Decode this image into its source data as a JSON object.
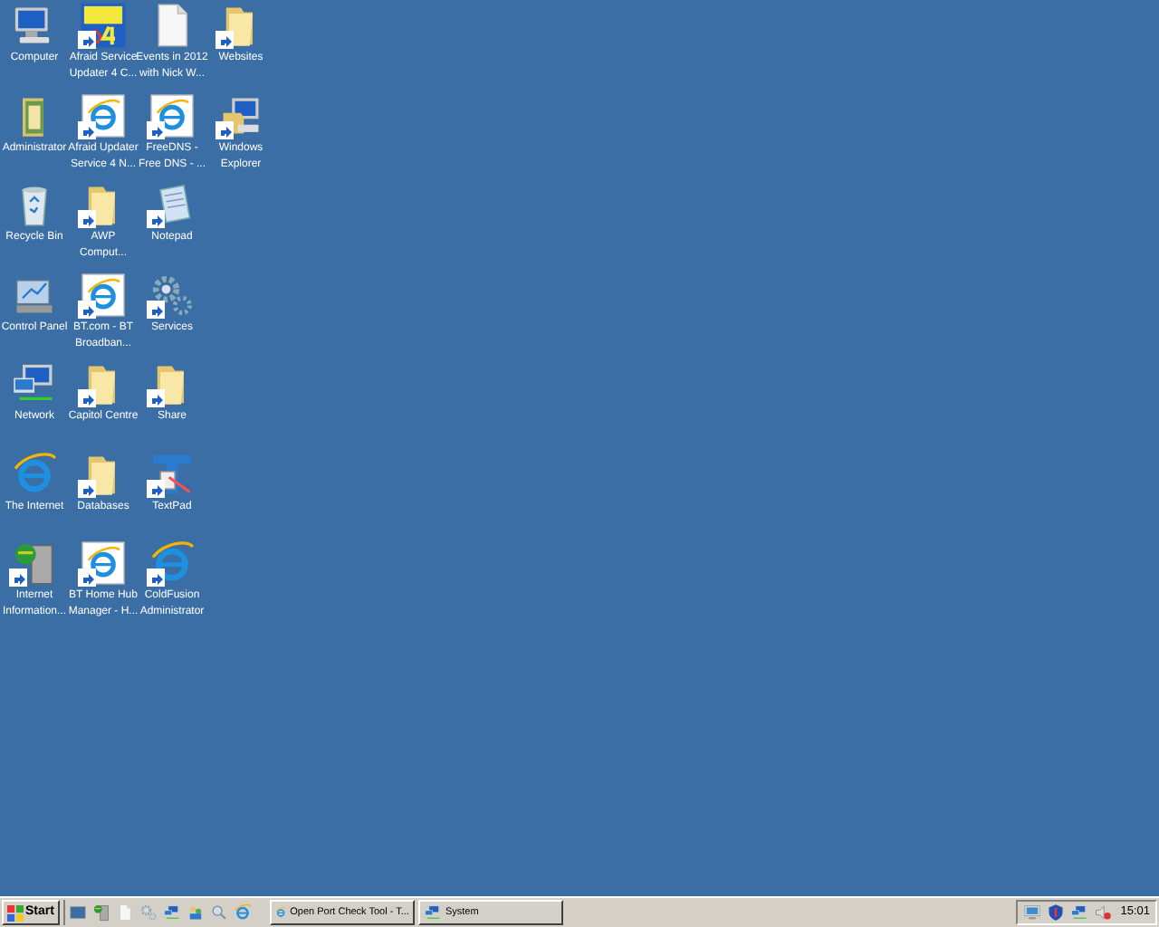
{
  "desktop": {
    "rows": [
      [
        {
          "kind": "computer",
          "lines": [
            "Computer"
          ],
          "shortcut": false
        },
        {
          "kind": "asu",
          "lines": [
            "Afraid Service",
            "Updater 4 C..."
          ],
          "shortcut": true
        },
        {
          "kind": "document",
          "lines": [
            "Events in 2012",
            "with Nick W..."
          ],
          "shortcut": false
        },
        {
          "kind": "folder",
          "lines": [
            "Websites"
          ],
          "shortcut": true
        }
      ],
      [
        {
          "kind": "user-folder",
          "lines": [
            "Administrator"
          ],
          "shortcut": false
        },
        {
          "kind": "ie-page",
          "lines": [
            "Afraid Updater",
            "Service 4  N..."
          ],
          "shortcut": true
        },
        {
          "kind": "ie-page",
          "lines": [
            "FreeDNS -",
            "Free DNS - ..."
          ],
          "shortcut": true
        },
        {
          "kind": "explorer",
          "lines": [
            "Windows",
            "Explorer"
          ],
          "shortcut": true
        }
      ],
      [
        {
          "kind": "recycle",
          "lines": [
            "Recycle Bin"
          ],
          "shortcut": false
        },
        {
          "kind": "folder",
          "lines": [
            "AWP",
            "Comput..."
          ],
          "shortcut": true
        },
        {
          "kind": "notepad",
          "lines": [
            "Notepad"
          ],
          "shortcut": true
        }
      ],
      [
        {
          "kind": "control-panel",
          "lines": [
            "Control Panel"
          ],
          "shortcut": false
        },
        {
          "kind": "ie-page",
          "lines": [
            "BT.com - BT",
            "Broadban..."
          ],
          "shortcut": true
        },
        {
          "kind": "gears",
          "lines": [
            "Services"
          ],
          "shortcut": true
        }
      ],
      [
        {
          "kind": "network",
          "lines": [
            "Network"
          ],
          "shortcut": false
        },
        {
          "kind": "folder",
          "lines": [
            "Capitol Centre"
          ],
          "shortcut": true
        },
        {
          "kind": "folder",
          "lines": [
            "Share"
          ],
          "shortcut": true
        }
      ],
      [
        {
          "kind": "ie",
          "lines": [
            "The Internet"
          ],
          "shortcut": false
        },
        {
          "kind": "folder",
          "lines": [
            "Databases"
          ],
          "shortcut": true
        },
        {
          "kind": "textpad",
          "lines": [
            "TextPad"
          ],
          "shortcut": true
        }
      ],
      [
        {
          "kind": "server",
          "lines": [
            "Internet",
            "Information..."
          ],
          "shortcut": true
        },
        {
          "kind": "ie-page",
          "lines": [
            "BT Home Hub",
            "Manager - H..."
          ],
          "shortcut": true
        },
        {
          "kind": "ie",
          "lines": [
            "ColdFusion",
            "Administrator"
          ],
          "shortcut": true
        }
      ]
    ]
  },
  "taskbar": {
    "start": "Start",
    "quick_launch": [
      {
        "kind": "desktop"
      },
      {
        "kind": "server"
      },
      {
        "kind": "document"
      },
      {
        "kind": "gears"
      },
      {
        "kind": "network"
      },
      {
        "kind": "people"
      },
      {
        "kind": "magnifier"
      },
      {
        "kind": "ie"
      }
    ],
    "tasks": [
      {
        "kind": "ie",
        "label": "Open Port Check Tool - T...",
        "selected": false
      },
      {
        "kind": "network",
        "label": "System",
        "selected": false
      }
    ],
    "tray": [
      {
        "kind": "monitor"
      },
      {
        "kind": "shield"
      },
      {
        "kind": "network"
      },
      {
        "kind": "sound"
      }
    ],
    "clock": "15:01"
  }
}
